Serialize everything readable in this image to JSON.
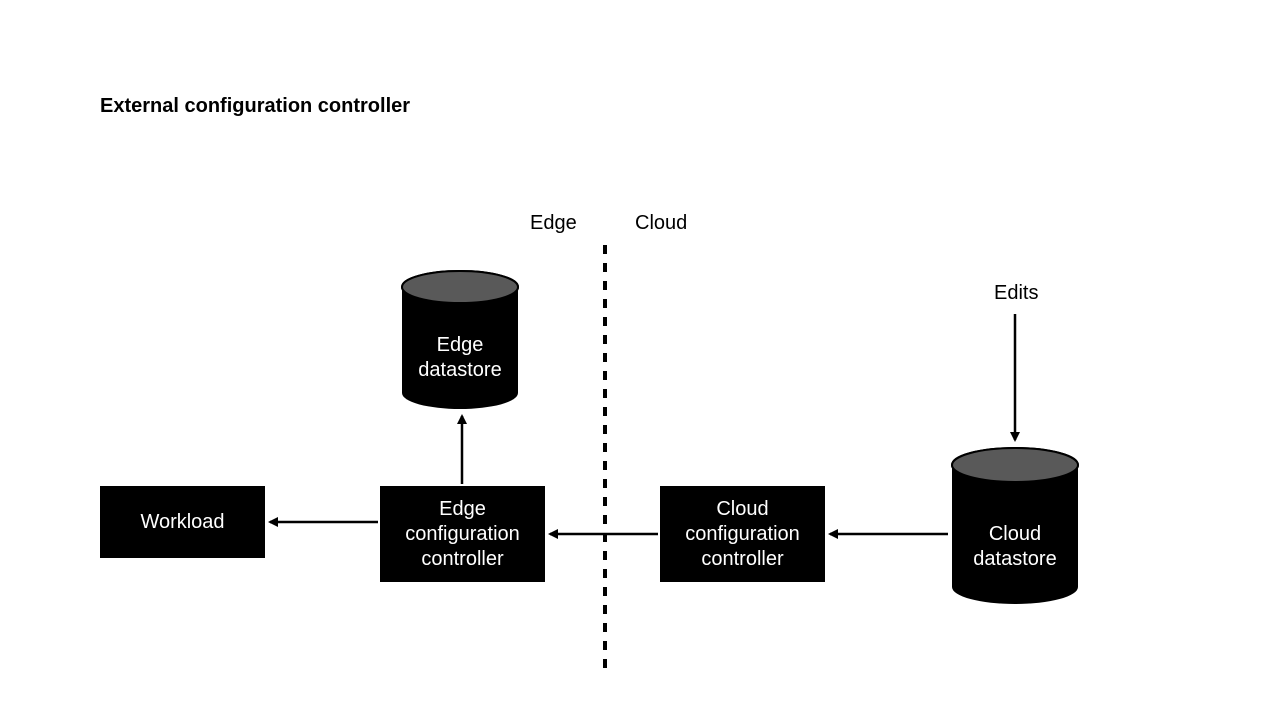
{
  "title": "External configuration controller",
  "labels": {
    "edge": "Edge",
    "cloud": "Cloud",
    "edits": "Edits"
  },
  "nodes": {
    "workload": "Workload",
    "edge_config_controller": "Edge configuration controller",
    "cloud_config_controller": "Cloud configuration controller",
    "edge_datastore": "Edge datastore",
    "cloud_datastore": "Cloud datastore"
  },
  "edges": [
    {
      "from": "cloud_datastore",
      "to": "cloud_config_controller"
    },
    {
      "from": "cloud_config_controller",
      "to": "edge_config_controller"
    },
    {
      "from": "edge_config_controller",
      "to": "workload"
    },
    {
      "from": "edge_config_controller",
      "to": "edge_datastore"
    },
    {
      "from": "edits",
      "to": "cloud_datastore"
    }
  ]
}
